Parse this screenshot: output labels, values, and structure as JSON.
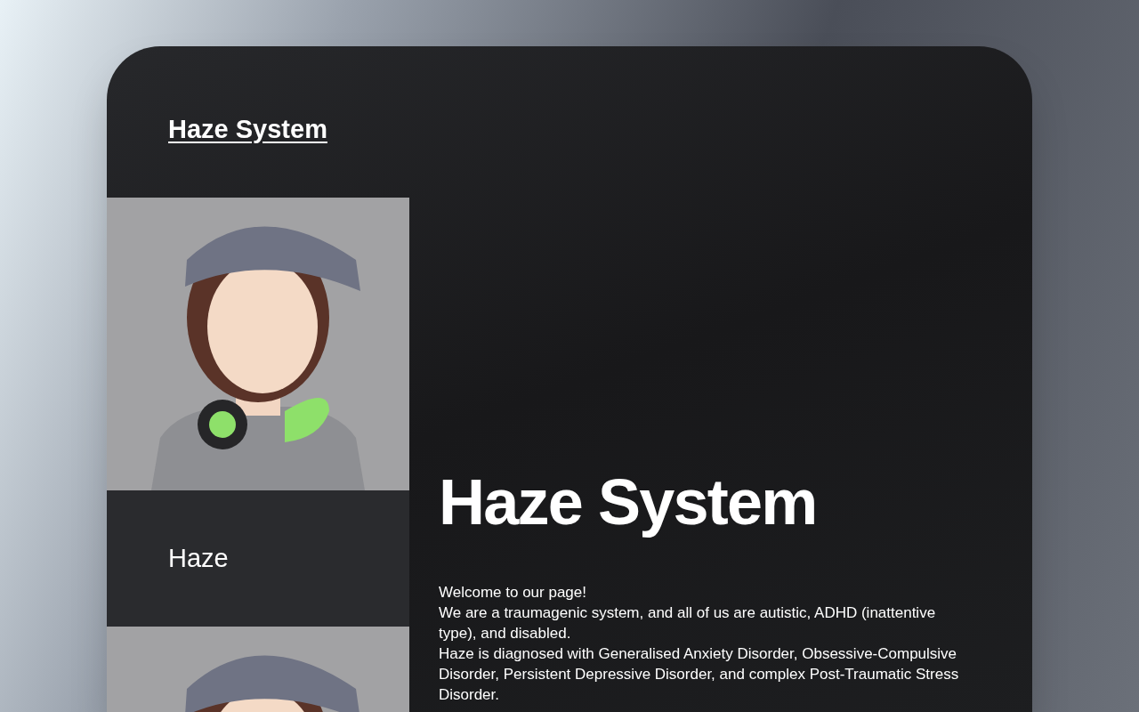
{
  "site_title": "Haze System",
  "members": [
    {
      "name": "Haze"
    }
  ],
  "heading": "Haze System",
  "paragraphs": [
    "Welcome to our page!",
    "We are a traumagenic system, and all of us are autistic, ADHD (inattentive type), and disabled.",
    "Haze is diagnosed with Generalised Anxiety Disorder, Obsessive-Compulsive Disorder, Persistent Depressive Disorder, and complex Post-Traumatic Stress Disorder."
  ]
}
